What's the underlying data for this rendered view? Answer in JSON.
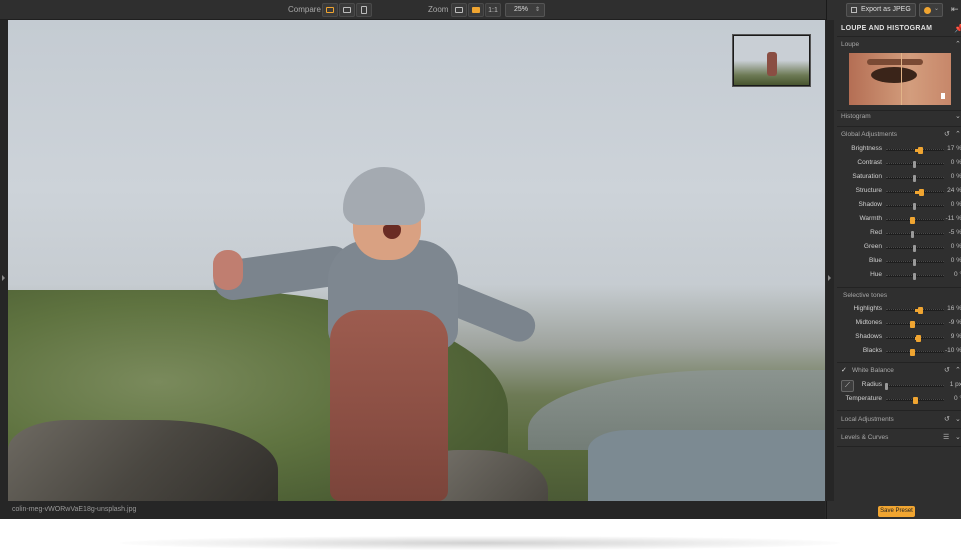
{
  "toolbar": {
    "compare_label": "Compare",
    "zoom_label": "Zoom",
    "zoom_1to1": "1:1",
    "zoom_value": "25%"
  },
  "photo": {
    "filename": "colin-meg-vWORwVaE18g-unsplash.jpg"
  },
  "panel": {
    "export_label": "Export as JPEG",
    "title": "LOUPE AND HISTOGRAM",
    "sections": {
      "loupe": "Loupe",
      "histogram": "Histogram",
      "global_adjustments": "Global Adjustments",
      "selective_tones": "Selective tones",
      "white_balance": "White Balance",
      "local_adjustments": "Local Adjustments",
      "levels_curves": "Levels & Curves"
    },
    "global": [
      {
        "label": "Brightness",
        "value": "17 %",
        "level": 0.58,
        "active": true
      },
      {
        "label": "Contrast",
        "value": "0 %",
        "level": 0.5,
        "active": false
      },
      {
        "label": "Saturation",
        "value": "0 %",
        "level": 0.5,
        "active": false
      },
      {
        "label": "Structure",
        "value": "24 %",
        "level": 0.6,
        "active": true
      },
      {
        "label": "Shadow",
        "value": "0 %",
        "level": 0.5,
        "active": false
      },
      {
        "label": "Warmth",
        "value": "-11 %",
        "level": 0.44,
        "active": true
      },
      {
        "label": "Red",
        "value": "-5 %",
        "level": 0.47,
        "active": false
      },
      {
        "label": "Green",
        "value": "0 %",
        "level": 0.5,
        "active": false
      },
      {
        "label": "Blue",
        "value": "0 %",
        "level": 0.5,
        "active": false
      },
      {
        "label": "Hue",
        "value": "0 °",
        "level": 0.5,
        "active": false
      }
    ],
    "tones": [
      {
        "label": "Highlights",
        "value": "16 %",
        "level": 0.58,
        "active": true
      },
      {
        "label": "Midtones",
        "value": "-9 %",
        "level": 0.45,
        "active": true
      },
      {
        "label": "Shadows",
        "value": "9 %",
        "level": 0.55,
        "active": true
      },
      {
        "label": "Blacks",
        "value": "-10 %",
        "level": 0.45,
        "active": true
      }
    ],
    "white_balance": [
      {
        "label": "Radius",
        "value": "1 px",
        "level": 0.02,
        "active": false
      },
      {
        "label": "Temperature",
        "value": "0 °",
        "level": 0.5,
        "active": true
      }
    ],
    "save_preset": "Save Preset"
  },
  "colors": {
    "accent": "#f0a531",
    "panel_bg": "#2f2f2f",
    "app_bg": "#2a2a2a"
  },
  "icons": [
    "compare-split-icon",
    "compare-side-icon",
    "compare-stack-icon",
    "zoom-fit-icon",
    "zoom-fill-icon",
    "export-icon",
    "color-circle-icon",
    "collapse-icon",
    "pin-icon",
    "chevron-up-icon",
    "chevron-down-icon",
    "reset-icon",
    "checkmark-icon",
    "eyedropper-icon",
    "list-icon"
  ]
}
